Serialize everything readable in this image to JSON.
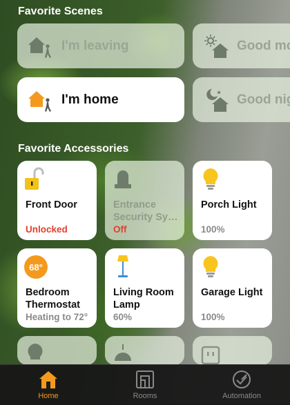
{
  "scenes": {
    "title": "Favorite Scenes",
    "items": [
      {
        "label": "I'm leaving",
        "icon": "house-leaving-icon",
        "active": false
      },
      {
        "label": "Good mo",
        "icon": "house-sun-icon",
        "active": false
      },
      {
        "label": "I'm home",
        "icon": "house-arriving-icon",
        "active": true
      },
      {
        "label": "Good nig",
        "icon": "house-moon-icon",
        "active": false
      }
    ]
  },
  "accessories": {
    "title": "Favorite Accessories",
    "items": [
      {
        "name": "Front Door",
        "status": "Unlocked",
        "icon": "lock-open-icon",
        "active": true
      },
      {
        "name": "Entrance Security Sy…",
        "status": "Off",
        "icon": "alarm-light-icon",
        "active": false
      },
      {
        "name": "Porch Light",
        "status": "100%",
        "icon": "bulb-icon",
        "active": true
      },
      {
        "name": "Bedroom Thermostat",
        "status": "Heating to 72°",
        "icon": "thermostat-icon",
        "active": true,
        "temperature": "68°"
      },
      {
        "name": "Living Room Lamp",
        "status": "60%",
        "icon": "floor-lamp-icon",
        "active": true
      },
      {
        "name": "Garage Light",
        "status": "100%",
        "icon": "bulb-icon",
        "active": true
      }
    ]
  },
  "tabs": [
    {
      "label": "Home",
      "icon": "home-tab-icon",
      "active": true
    },
    {
      "label": "Rooms",
      "icon": "rooms-tab-icon",
      "active": false
    },
    {
      "label": "Automation",
      "icon": "automation-tab-icon",
      "active": false
    }
  ],
  "colors": {
    "accent": "#f39a1e",
    "alert": "#e2402c",
    "bulb": "#f7c51e"
  }
}
